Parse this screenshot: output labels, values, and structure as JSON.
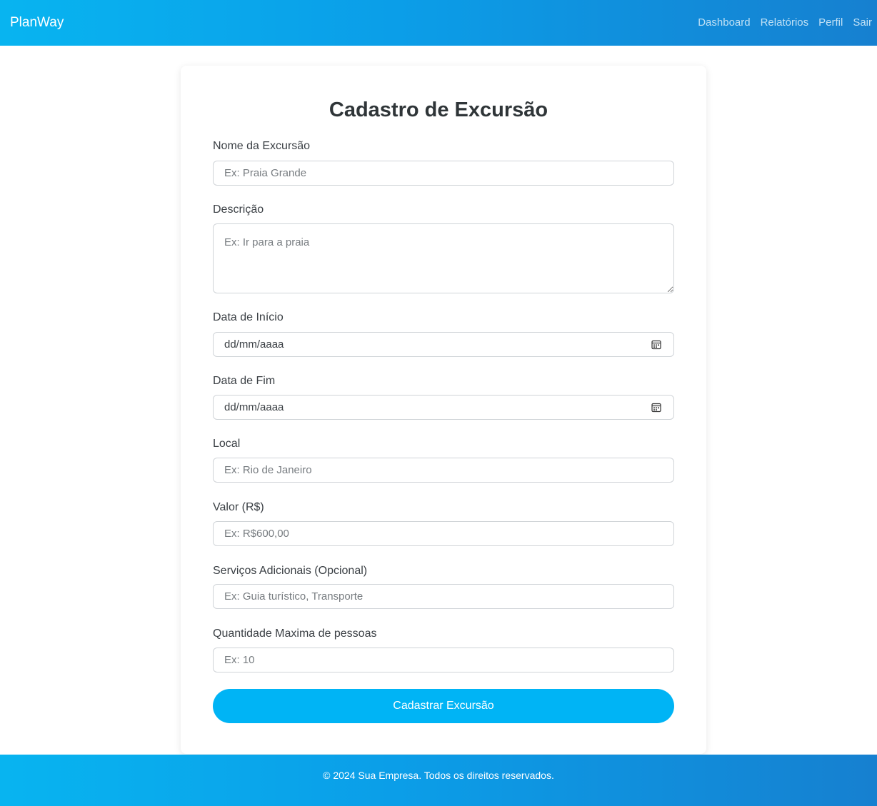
{
  "header": {
    "brand": "PlanWay",
    "nav": [
      "Dashboard",
      "Relatórios",
      "Perfil",
      "Sair"
    ]
  },
  "form": {
    "title": "Cadastro de Excursão",
    "name": {
      "label": "Nome da Excursão",
      "placeholder": "Ex: Praia Grande"
    },
    "description": {
      "label": "Descrição",
      "placeholder": "Ex: Ir para a praia"
    },
    "start_date": {
      "label": "Data de Início",
      "value": "dd/mm/aaaa"
    },
    "end_date": {
      "label": "Data de Fim",
      "value": "dd/mm/aaaa"
    },
    "location": {
      "label": "Local",
      "placeholder": "Ex: Rio de Janeiro"
    },
    "price": {
      "label": "Valor (R$)",
      "placeholder": "Ex: R$600,00"
    },
    "extra_services": {
      "label": "Serviços Adicionais (Opcional)",
      "placeholder": "Ex: Guia turístico, Transporte"
    },
    "max_people": {
      "label": "Quantidade Maxima de pessoas",
      "placeholder": "Ex: 10"
    },
    "submit_label": "Cadastrar Excursão"
  },
  "footer": {
    "text": "© 2024 Sua Empresa. Todos os direitos reservados."
  },
  "colors": {
    "accent": "#00b4f5",
    "header_gradient_start": "#08b4f0",
    "header_gradient_end": "#1680d0"
  },
  "icons": {
    "date_picker": "calendar-icon"
  }
}
